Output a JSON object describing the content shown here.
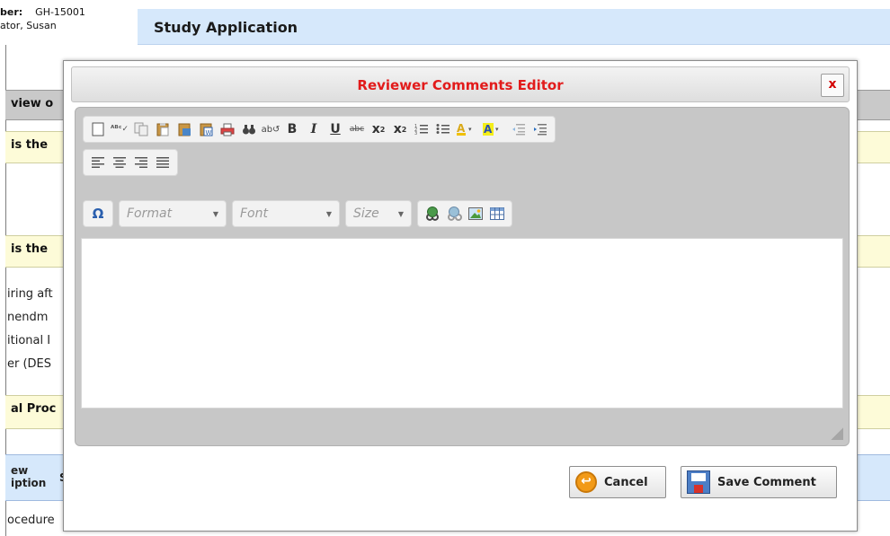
{
  "background": {
    "protocol_label": "ber:",
    "protocol_number": "GH-15001",
    "investigator": "ator, Susan",
    "page_title": "Study Application",
    "section_review": "view o",
    "question_1": "is the",
    "question_2": "is the",
    "text_lines": [
      "iring aft",
      "nendm",
      "itional I",
      "er (DES"
    ],
    "section_procedures": "al Proc",
    "table_head_col1_line1": "ew",
    "table_head_col1_line2": "iption",
    "table_head_col2": "S",
    "table_row_1": "ocedure"
  },
  "modal": {
    "title": "Reviewer Comments Editor",
    "close_label": "x",
    "toolbar": {
      "combos": [
        {
          "label": "Format"
        },
        {
          "label": "Font"
        },
        {
          "label": "Size"
        }
      ]
    },
    "buttons": {
      "cancel": "Cancel",
      "save": "Save Comment"
    }
  }
}
